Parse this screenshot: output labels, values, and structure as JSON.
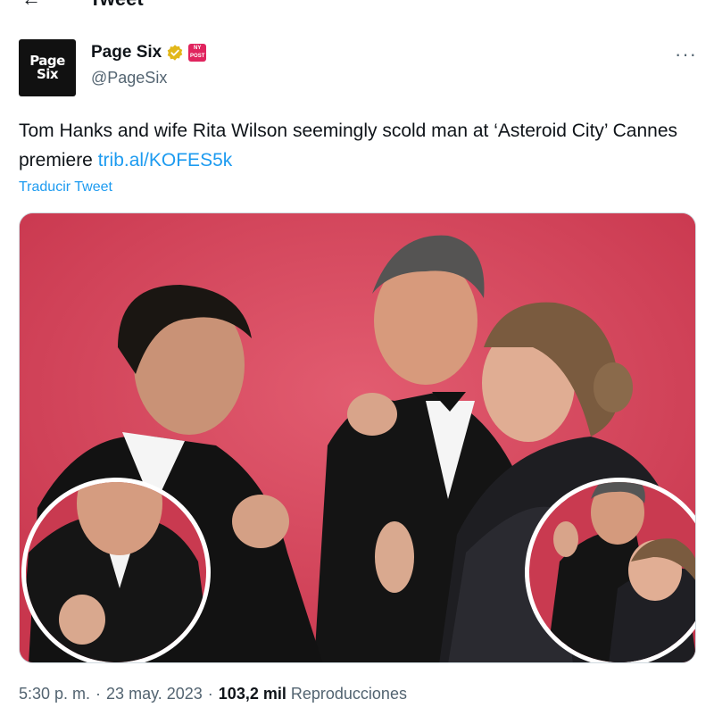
{
  "header": {
    "back_icon": "arrow-left-icon",
    "title": "Tweet"
  },
  "author": {
    "avatar_line1": "Page",
    "avatar_line2": "Six",
    "name": "Page Six",
    "handle": "@PageSix",
    "verified_icon": "gold-verified-badge-icon",
    "affiliate_icon": "affiliate-badge-icon",
    "affiliate_text": "NY POST"
  },
  "more_label": "···",
  "tweet": {
    "text": "Tom Hanks and wife Rita Wilson seemingly scold man at ‘Asteroid City’ Cannes premiere ",
    "link": "trib.al/KOFES5k",
    "translate": "Traducir Tweet"
  },
  "media": {
    "kind": "photo",
    "accent": "#d0435a"
  },
  "meta": {
    "time": "5:30 p. m.",
    "sep1": "·",
    "date": "23 may. 2023",
    "sep2": "·",
    "views_count": "103,2 mil",
    "views_label": "Reproducciones"
  },
  "colors": {
    "link": "#1d9bf0",
    "muted": "#536471",
    "text": "#0f1419"
  }
}
